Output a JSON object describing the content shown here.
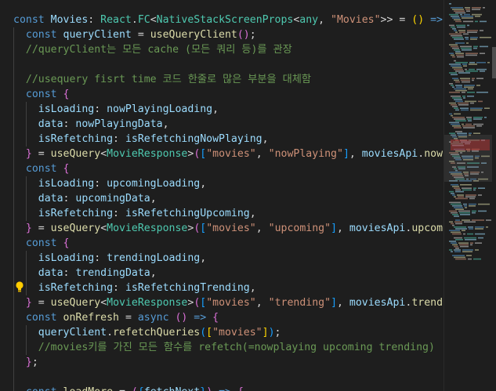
{
  "colors": {
    "background": "#1e1e1e",
    "keyword": "#569cd6",
    "identifier": "#9cdcfe",
    "function": "#dcdcaa",
    "type": "#4ec9b0",
    "string": "#ce9178",
    "comment": "#6a9955",
    "bracket1": "#ffd700",
    "bracket2": "#da70d6",
    "bracket3": "#179fff",
    "plain": "#d4d4d4"
  },
  "editor": {
    "lightbulb_icon": "lightbulb-icon",
    "lines": [
      [
        [
          "const ",
          "k"
        ],
        [
          "Movies",
          "v"
        ],
        [
          ": ",
          "p"
        ],
        [
          "React",
          "t"
        ],
        [
          ".",
          "p"
        ],
        [
          "FC",
          "t"
        ],
        [
          "<",
          "p"
        ],
        [
          "NativeStackScreenProps",
          "t"
        ],
        [
          "<",
          "p"
        ],
        [
          "any",
          "t"
        ],
        [
          ", ",
          "p"
        ],
        [
          "\"Movies\"",
          "s"
        ],
        [
          ">> = ",
          "p"
        ],
        [
          "()",
          "b1"
        ],
        [
          " => ",
          "k"
        ],
        [
          "{",
          "b1"
        ]
      ],
      [
        [
          "  const ",
          "k"
        ],
        [
          "queryClient",
          "v"
        ],
        [
          " = ",
          "p"
        ],
        [
          "useQueryClient",
          "f"
        ],
        [
          "()",
          "b2"
        ],
        [
          ";",
          "p"
        ]
      ],
      [
        [
          "  //queryClient는 모든 cache (모든 쿼리 등)를 관장",
          "c"
        ]
      ],
      [
        [
          "",
          "p"
        ]
      ],
      [
        [
          "  //usequery fisrt time 코드 한줄로 많은 부분을 대체함",
          "c"
        ]
      ],
      [
        [
          "  const ",
          "k"
        ],
        [
          "{",
          "b2"
        ]
      ],
      [
        [
          "    isLoading",
          "v"
        ],
        [
          ": ",
          "p"
        ],
        [
          "nowPlayingLoading",
          "v"
        ],
        [
          ",",
          "p"
        ]
      ],
      [
        [
          "    data",
          "v"
        ],
        [
          ": ",
          "p"
        ],
        [
          "nowPlayingData",
          "v"
        ],
        [
          ",",
          "p"
        ]
      ],
      [
        [
          "    isRefetching",
          "v"
        ],
        [
          ": ",
          "p"
        ],
        [
          "isRefetchingNowPlaying",
          "v"
        ],
        [
          ",",
          "p"
        ]
      ],
      [
        [
          "  ",
          "p"
        ],
        [
          "}",
          "b2"
        ],
        [
          " = ",
          "p"
        ],
        [
          "useQuery",
          "f"
        ],
        [
          "<",
          "p"
        ],
        [
          "MovieResponse",
          "t"
        ],
        [
          ">",
          "p"
        ],
        [
          "(",
          "b2"
        ],
        [
          "[",
          "b3"
        ],
        [
          "\"movies\"",
          "s"
        ],
        [
          ", ",
          "p"
        ],
        [
          "\"nowPlaying\"",
          "s"
        ],
        [
          "]",
          "b3"
        ],
        [
          ", ",
          "p"
        ],
        [
          "moviesApi",
          "v"
        ],
        [
          ".",
          "p"
        ],
        [
          "nowPlaying",
          "f"
        ]
      ],
      [
        [
          "  const ",
          "k"
        ],
        [
          "{",
          "b2"
        ]
      ],
      [
        [
          "    isLoading",
          "v"
        ],
        [
          ": ",
          "p"
        ],
        [
          "upcomingLoading",
          "v"
        ],
        [
          ",",
          "p"
        ]
      ],
      [
        [
          "    data",
          "v"
        ],
        [
          ": ",
          "p"
        ],
        [
          "upcomingData",
          "v"
        ],
        [
          ",",
          "p"
        ]
      ],
      [
        [
          "    isRefetching",
          "v"
        ],
        [
          ": ",
          "p"
        ],
        [
          "isRefetchingUpcoming",
          "v"
        ],
        [
          ",",
          "p"
        ]
      ],
      [
        [
          "  ",
          "p"
        ],
        [
          "}",
          "b2"
        ],
        [
          " = ",
          "p"
        ],
        [
          "useQuery",
          "f"
        ],
        [
          "<",
          "p"
        ],
        [
          "MovieResponse",
          "t"
        ],
        [
          ">",
          "p"
        ],
        [
          "(",
          "b2"
        ],
        [
          "[",
          "b3"
        ],
        [
          "\"movies\"",
          "s"
        ],
        [
          ", ",
          "p"
        ],
        [
          "\"upcoming\"",
          "s"
        ],
        [
          "]",
          "b3"
        ],
        [
          ", ",
          "p"
        ],
        [
          "moviesApi",
          "v"
        ],
        [
          ".",
          "p"
        ],
        [
          "upcoming",
          "f"
        ]
      ],
      [
        [
          "  const ",
          "k"
        ],
        [
          "{",
          "b2"
        ]
      ],
      [
        [
          "    isLoading",
          "v"
        ],
        [
          ": ",
          "p"
        ],
        [
          "trendingLoading",
          "v"
        ],
        [
          ",",
          "p"
        ]
      ],
      [
        [
          "    data",
          "v"
        ],
        [
          ": ",
          "p"
        ],
        [
          "trendingData",
          "v"
        ],
        [
          ",",
          "p"
        ]
      ],
      [
        [
          "    isRefetching",
          "v"
        ],
        [
          ": ",
          "p"
        ],
        [
          "isRefetchingTrending",
          "v"
        ],
        [
          ",",
          "p"
        ]
      ],
      [
        [
          "  ",
          "p"
        ],
        [
          "}",
          "b2"
        ],
        [
          " = ",
          "p"
        ],
        [
          "useQuery",
          "f"
        ],
        [
          "<",
          "p"
        ],
        [
          "MovieResponse",
          "t"
        ],
        [
          ">",
          "p"
        ],
        [
          "(",
          "b2"
        ],
        [
          "[",
          "b3"
        ],
        [
          "\"movies\"",
          "s"
        ],
        [
          ", ",
          "p"
        ],
        [
          "\"trending\"",
          "s"
        ],
        [
          "]",
          "b3"
        ],
        [
          ", ",
          "p"
        ],
        [
          "moviesApi",
          "v"
        ],
        [
          ".",
          "p"
        ],
        [
          "trending",
          "f"
        ]
      ],
      [
        [
          "  const ",
          "k"
        ],
        [
          "onRefresh",
          "f"
        ],
        [
          " = ",
          "p"
        ],
        [
          "async ",
          "k"
        ],
        [
          "()",
          "b2"
        ],
        [
          " => ",
          "k"
        ],
        [
          "{",
          "b2"
        ]
      ],
      [
        [
          "    queryClient",
          "v"
        ],
        [
          ".",
          "p"
        ],
        [
          "refetchQueries",
          "f"
        ],
        [
          "(",
          "b3"
        ],
        [
          "[",
          "b1"
        ],
        [
          "\"movies\"",
          "s"
        ],
        [
          "]",
          "b1"
        ],
        [
          ")",
          "b3"
        ],
        [
          ";",
          "p"
        ]
      ],
      [
        [
          "    //movies키를 가진 모든 함수를 refetch(=nowplaying upcoming trending)",
          "c"
        ]
      ],
      [
        [
          "  ",
          "p"
        ],
        [
          "}",
          "b2"
        ],
        [
          ";",
          "p"
        ]
      ],
      [
        [
          "",
          "p"
        ]
      ],
      [
        [
          "  const ",
          "k"
        ],
        [
          "loadMore",
          "f"
        ],
        [
          " = ",
          "p"
        ],
        [
          "(",
          "b2"
        ],
        [
          "{",
          "b3"
        ],
        [
          "fetchNext",
          "v"
        ],
        [
          "}",
          "b3"
        ],
        [
          ")",
          "b2"
        ],
        [
          " => ",
          "k"
        ],
        [
          "{",
          "b2"
        ]
      ]
    ]
  }
}
